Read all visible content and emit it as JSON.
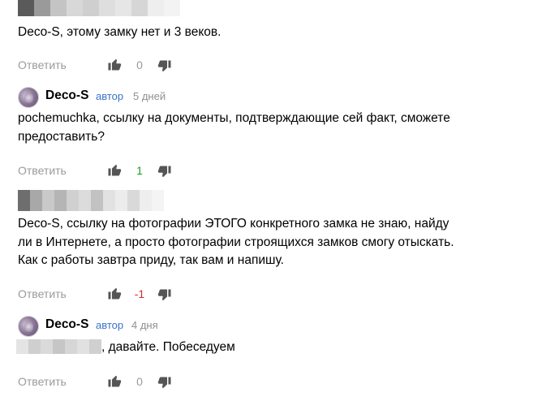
{
  "colors": {
    "reply": "#9a9a9a",
    "like_positive": "#1f9a1f",
    "like_negative": "#d22d2d",
    "author_badge": "#3a73c7",
    "icon": "#555555"
  },
  "comments": [
    {
      "text": "Deco-S, этому замку нет и 3 веков.",
      "reply_label": "Ответить",
      "like_count": "0"
    },
    {
      "author": "Deco-S",
      "badge": "автор",
      "age": "5 дней",
      "text_lines": [
        "pochemuchka, ссылку на документы, подтверждающие сей факт, сможете",
        "предоставить?"
      ],
      "reply_label": "Ответить",
      "like_count": "1"
    },
    {
      "text_lines": [
        "Deco-S, ссылку на фотографии ЭТОГО конкретного замка не знаю, найду",
        "ли в Интернете, а просто фотографии строящихся замков смогу отыскать.",
        "Как с работы завтра приду, так вам и напишу."
      ],
      "reply_label": "Ответить",
      "like_count": "-1"
    },
    {
      "author": "Deco-S",
      "badge": "автор",
      "age": "4 дня",
      "text": ", давайте. Побеседуем",
      "reply_label": "Ответить",
      "like_count": "0"
    }
  ]
}
